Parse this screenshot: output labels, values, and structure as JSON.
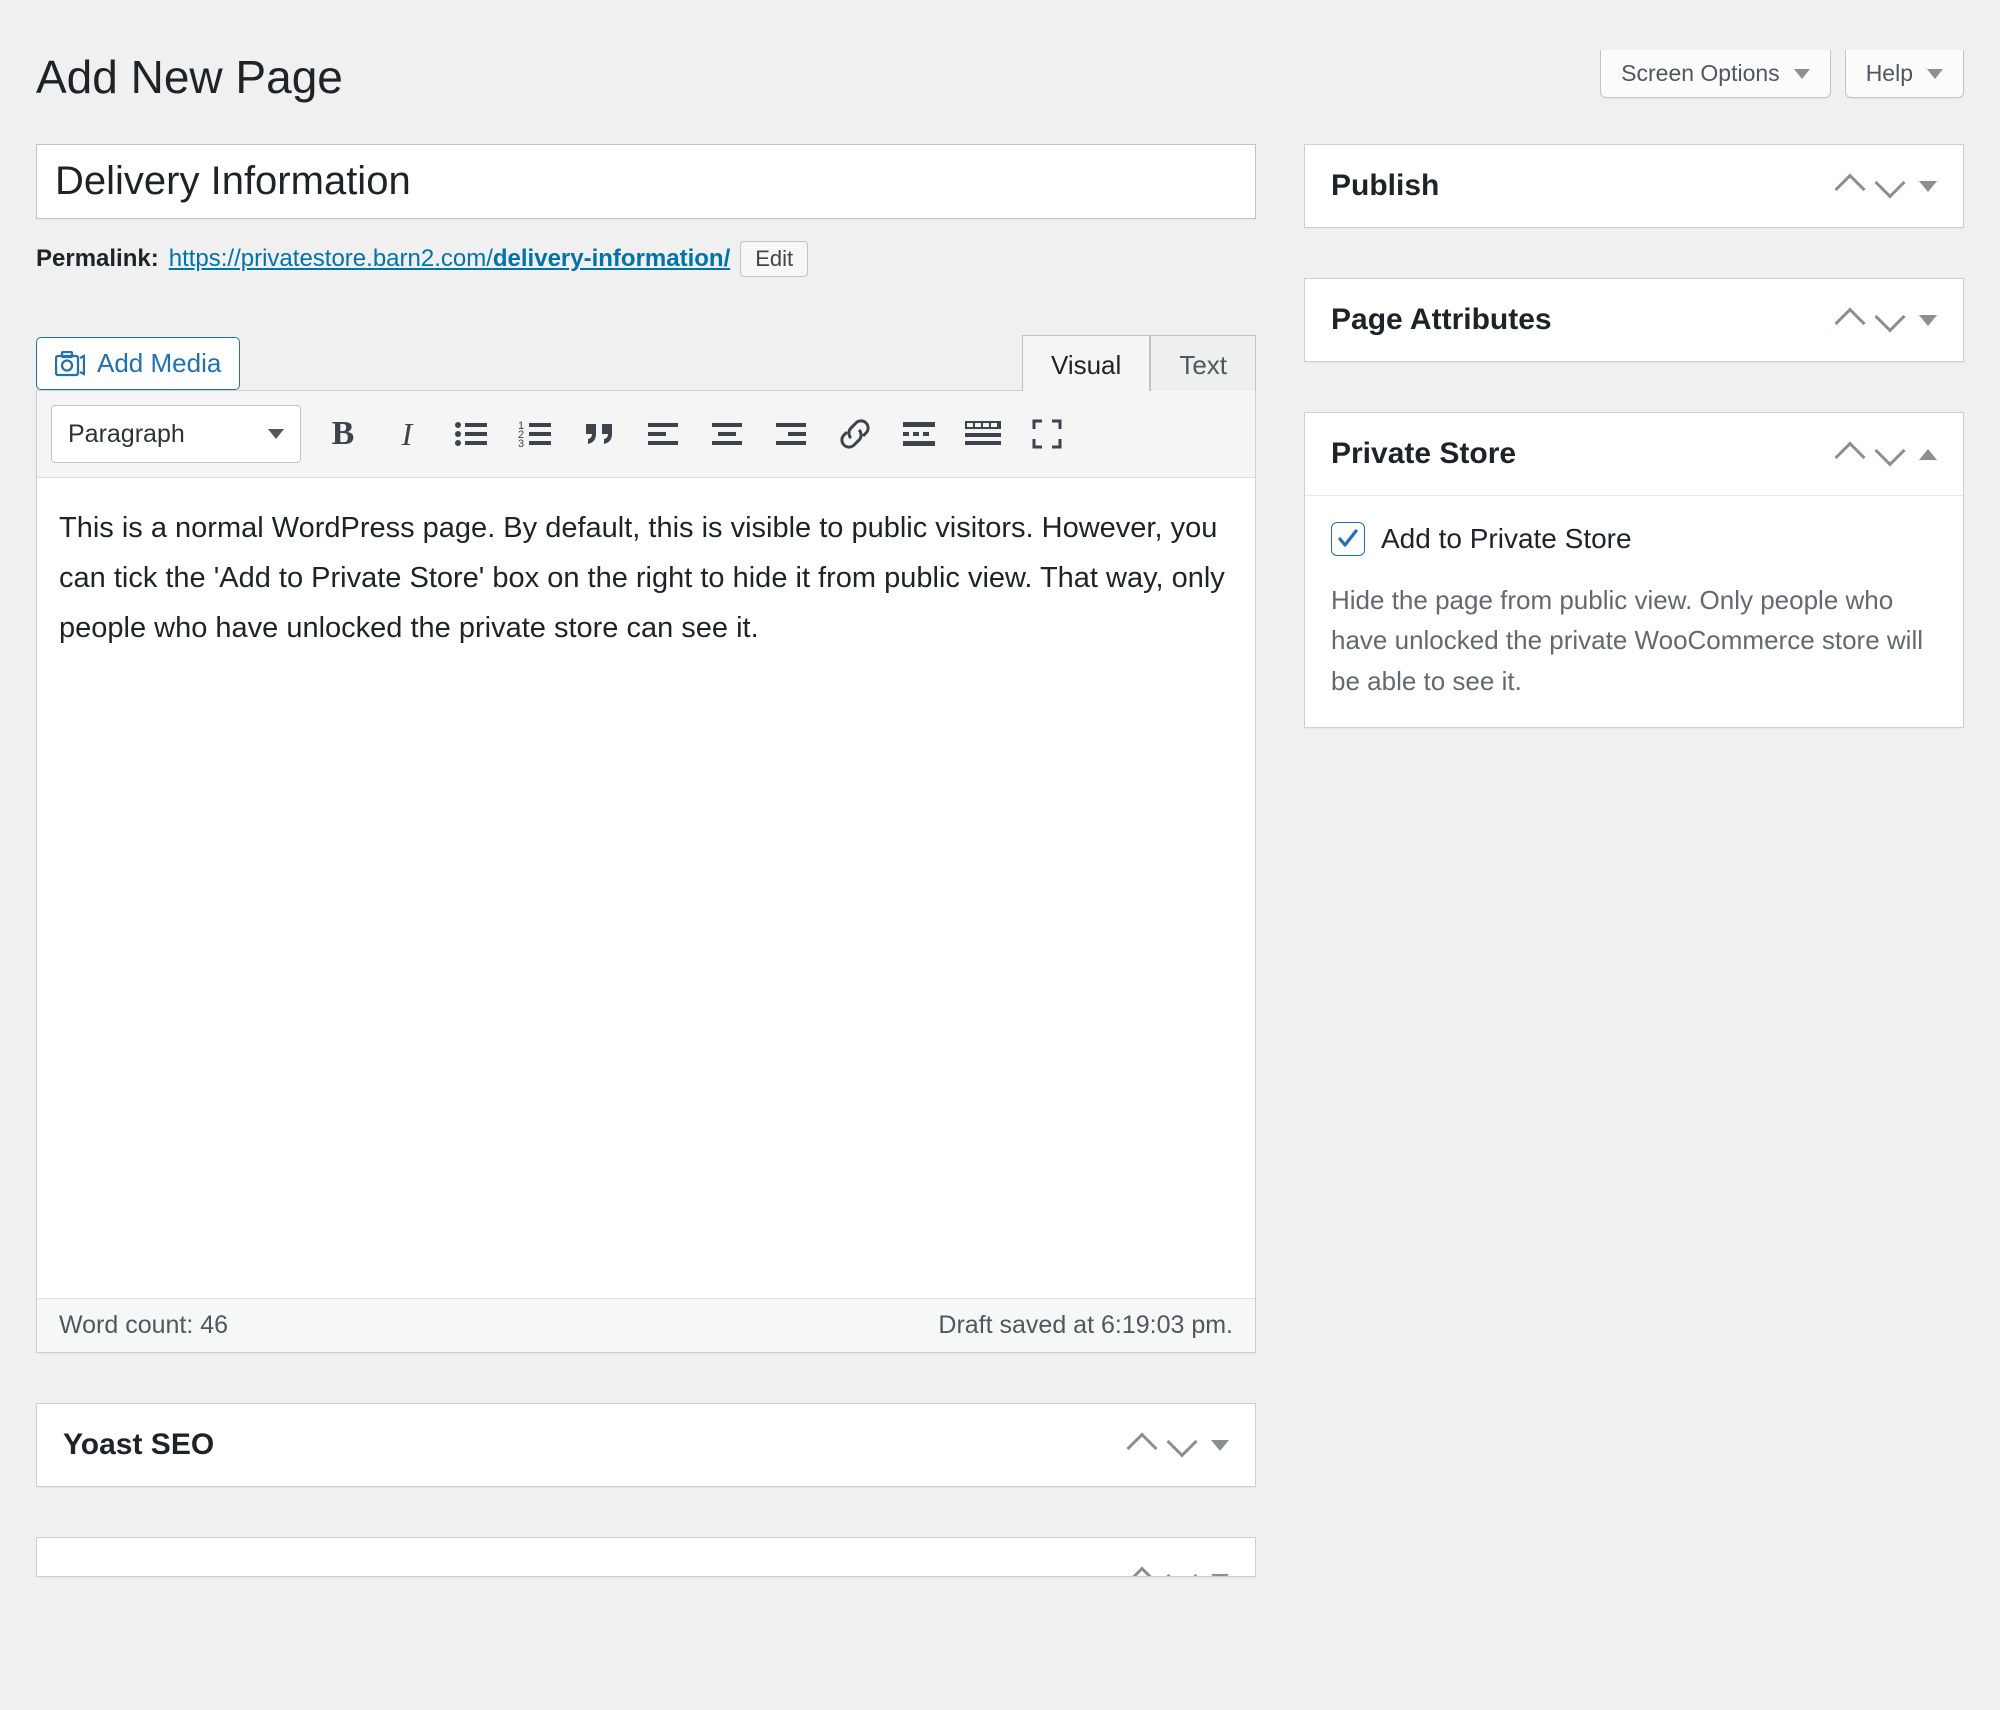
{
  "top": {
    "screen_options": "Screen Options",
    "help": "Help"
  },
  "heading": "Add New Page",
  "title_value": "Delivery Information",
  "permalink": {
    "label": "Permalink:",
    "base": "https://privatestore.barn2.com/",
    "slug": "delivery-information/",
    "edit": "Edit"
  },
  "media_button": "Add Media",
  "tabs": {
    "visual": "Visual",
    "text": "Text"
  },
  "format_dropdown": "Paragraph",
  "body_text": "This is a normal WordPress page. By default, this is visible to public visitors. However, you can tick the 'Add to Private Store' box on the right to hide it from public view. That way, only people who have unlocked the private store can see it.",
  "status": {
    "word_count": "Word count: 46",
    "draft_saved": "Draft saved at 6:19:03 pm."
  },
  "metaboxes": {
    "yoast": "Yoast SEO"
  },
  "side": {
    "publish": {
      "title": "Publish"
    },
    "page_attributes": {
      "title": "Page Attributes"
    },
    "private_store": {
      "title": "Private Store",
      "checkbox": "Add to Private Store",
      "checked": true,
      "desc": "Hide the page from public view. Only people who have unlocked the private WooCommerce store will be able to see it."
    }
  }
}
